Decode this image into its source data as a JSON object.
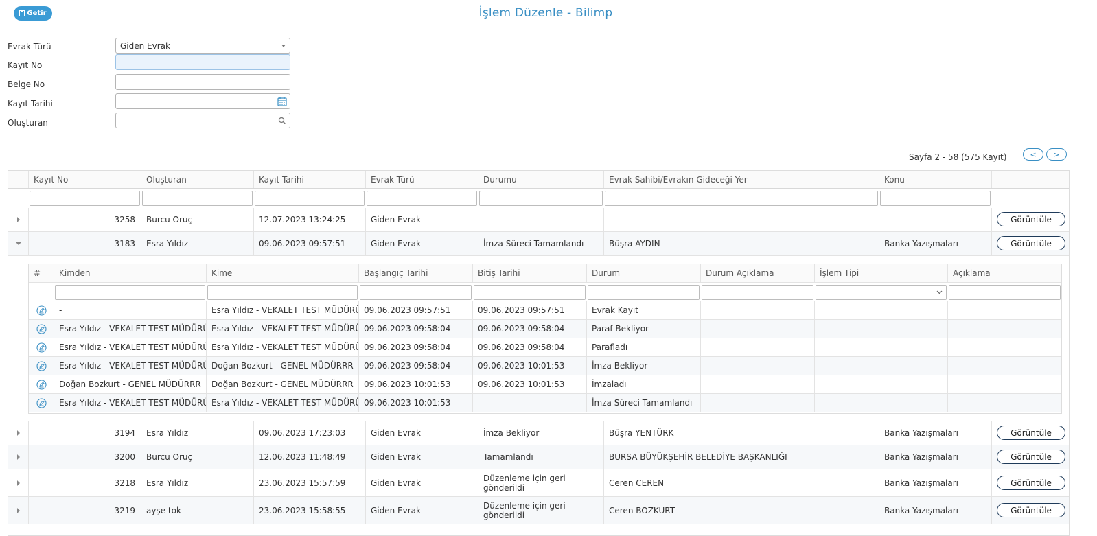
{
  "toolbar": {
    "getir_label": "Getir"
  },
  "title": "İşlem Düzenle - Bilimp",
  "form": {
    "evrak_turu_label": "Evrak Türü",
    "evrak_turu_value": "Giden Evrak",
    "kayit_no_label": "Kayıt No",
    "kayit_no_value": "",
    "belge_no_label": "Belge No",
    "belge_no_value": "",
    "kayit_tarihi_label": "Kayıt Tarihi",
    "kayit_tarihi_value": "",
    "olusturan_label": "Oluşturan",
    "olusturan_value": ""
  },
  "pager": {
    "text": "Sayfa 2 - 58 (575 Kayıt)",
    "prev": "<",
    "next": ">"
  },
  "grid": {
    "columns": [
      "Kayıt No",
      "Oluşturan",
      "Kayıt Tarihi",
      "Evrak Türü",
      "Durumu",
      "Evrak Sahibi/Evrakın Gideceği Yer",
      "Konu"
    ],
    "action_label": "Görüntüle",
    "rows": [
      {
        "kayit_no": "3258",
        "olusturan": "Burcu Oruç",
        "kayit_tarihi": "12.07.2023 13:24:25",
        "evrak_turu": "Giden Evrak",
        "durumu": "",
        "yer": "",
        "konu": ""
      },
      {
        "kayit_no": "3183",
        "olusturan": "Esra Yıldız",
        "kayit_tarihi": "09.06.2023 09:57:51",
        "evrak_turu": "Giden Evrak",
        "durumu": "İmza Süreci Tamamlandı",
        "yer": "Büşra AYDIN",
        "konu": "Banka Yazışmaları"
      },
      {
        "kayit_no": "3194",
        "olusturan": "Esra Yıldız",
        "kayit_tarihi": "09.06.2023 17:23:03",
        "evrak_turu": "Giden Evrak",
        "durumu": "İmza Bekliyor",
        "yer": "Büşra YENTÜRK",
        "konu": "Banka Yazışmaları"
      },
      {
        "kayit_no": "3200",
        "olusturan": "Burcu Oruç",
        "kayit_tarihi": "12.06.2023 11:48:49",
        "evrak_turu": "Giden Evrak",
        "durumu": "Tamamlandı",
        "yer": "BURSA BÜYÜKŞEHİR BELEDİYE BAŞKANLIĞI",
        "konu": "Banka Yazışmaları"
      },
      {
        "kayit_no": "3218",
        "olusturan": "Esra Yıldız",
        "kayit_tarihi": "23.06.2023 15:57:59",
        "evrak_turu": "Giden Evrak",
        "durumu": "Düzenleme için geri gönderildi",
        "yer": "Ceren CEREN",
        "konu": "Banka Yazışmaları"
      },
      {
        "kayit_no": "3219",
        "olusturan": "ayşe tok",
        "kayit_tarihi": "23.06.2023 15:58:55",
        "evrak_turu": "Giden Evrak",
        "durumu": "Düzenleme için geri gönderildi",
        "yer": "Ceren BOZKURT",
        "konu": "Banka Yazışmaları"
      }
    ]
  },
  "detail": {
    "columns": [
      "#",
      "Kimden",
      "Kime",
      "Başlangıç Tarihi",
      "Bitiş Tarihi",
      "Durum",
      "Durum Açıklama",
      "İşlem Tipi",
      "Açıklama"
    ],
    "rows": [
      {
        "kimden": "-",
        "kime": "Esra Yıldız - VEKALET TEST MÜDÜRÜ",
        "baslangic": "09.06.2023 09:57:51",
        "bitis": "09.06.2023 09:57:51",
        "durum": "Evrak Kayıt"
      },
      {
        "kimden": "Esra Yıldız - VEKALET TEST MÜDÜRÜ",
        "kime": "Esra Yıldız - VEKALET TEST MÜDÜRÜ",
        "baslangic": "09.06.2023 09:58:04",
        "bitis": "09.06.2023 09:58:04",
        "durum": "Paraf Bekliyor"
      },
      {
        "kimden": "Esra Yıldız - VEKALET TEST MÜDÜRÜ",
        "kime": "Esra Yıldız - VEKALET TEST MÜDÜRÜ",
        "baslangic": "09.06.2023 09:58:04",
        "bitis": "09.06.2023 09:58:04",
        "durum": "Parafladı"
      },
      {
        "kimden": "Esra Yıldız - VEKALET TEST MÜDÜRÜ",
        "kime": "Doğan Bozkurt - GENEL MÜDÜRRR",
        "baslangic": "09.06.2023 09:58:04",
        "bitis": "09.06.2023 10:01:53",
        "durum": "İmza Bekliyor"
      },
      {
        "kimden": "Doğan Bozkurt - GENEL MÜDÜRRR",
        "kime": "Doğan Bozkurt - GENEL MÜDÜRRR",
        "baslangic": "09.06.2023 10:01:53",
        "bitis": "09.06.2023 10:01:53",
        "durum": "İmzaladı"
      },
      {
        "kimden": "Esra Yıldız - VEKALET TEST MÜDÜRÜ",
        "kime": "Esra Yıldız - VEKALET TEST MÜDÜRÜ",
        "baslangic": "09.06.2023 10:01:53",
        "bitis": "",
        "durum": "İmza Süreci Tamamlandı"
      }
    ]
  },
  "colors": {
    "accent": "#3a9bd5",
    "title": "#3a8fc4",
    "button_border": "#1f3b5a"
  },
  "icons": {
    "getir": "save-icon",
    "calendar": "calendar-icon",
    "search": "search-icon",
    "edit": "edit-icon"
  }
}
